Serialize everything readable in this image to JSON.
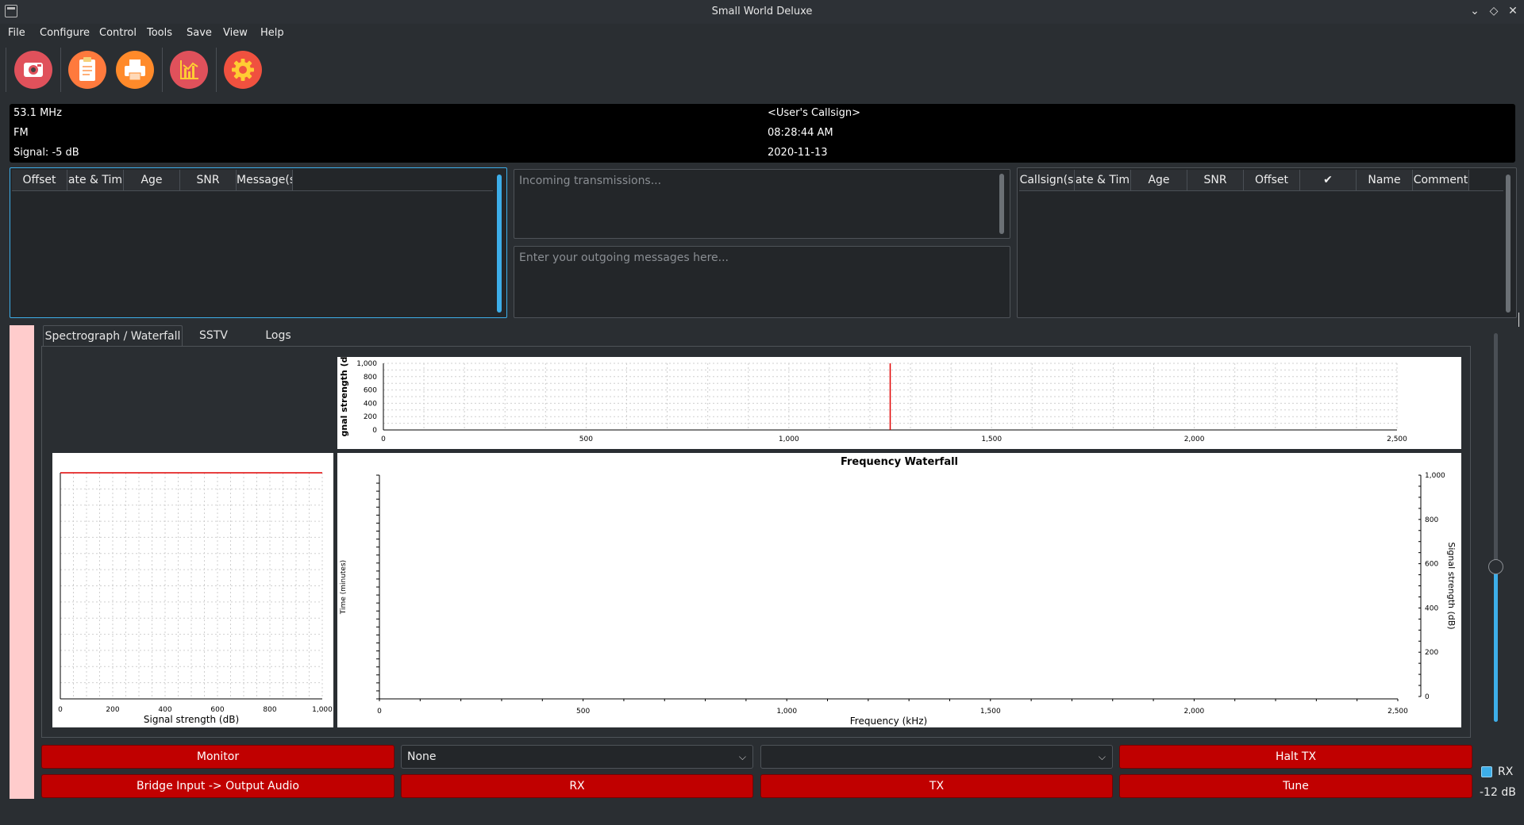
{
  "window": {
    "title": "Small World Deluxe"
  },
  "menu": [
    "File",
    "Configure",
    "Control",
    "Tools",
    "Save",
    "View",
    "Help"
  ],
  "toolbar": {
    "icons": [
      "camera-icon",
      "clipboard-icon",
      "printer-icon",
      "chart-icon",
      "settings-gear-icon"
    ],
    "colors": {
      "camera": "#e0515b",
      "clipboard": "#ff7a3d",
      "printer": "#ff8a2a",
      "chart": "#e0515b",
      "gear": "#f0513f"
    }
  },
  "info": {
    "frequency": "53.1 MHz",
    "mode": "FM",
    "signal": "Signal: -5 dB",
    "callsign": "<User's Callsign>",
    "time": "08:28:44 AM",
    "date": "2020-11-13"
  },
  "left_table": {
    "columns": [
      "Offset",
      "ate & Tim",
      "Age",
      "SNR",
      "Message(s"
    ]
  },
  "incoming": {
    "placeholder": "Incoming transmissions..."
  },
  "outgoing": {
    "placeholder": "Enter your outgoing messages here..."
  },
  "right_table": {
    "columns": [
      "Callsign(s",
      "ate & Tim",
      "Age",
      "SNR",
      "Offset",
      "✔",
      "Name",
      "Comment"
    ]
  },
  "tabs": [
    "Spectrograph / Waterfall",
    "SSTV",
    "Logs"
  ],
  "spectrum_chart": {
    "ylabel": "gnal strength (d",
    "y_ticks": [
      "1,000",
      "800",
      "600",
      "400",
      "200",
      "0"
    ],
    "x_ticks": [
      "0",
      "500",
      "1,000",
      "1,500",
      "2,000",
      "2,500"
    ],
    "marker_x": 1250
  },
  "signal_chart": {
    "xlabel": "Signal strength (dB)",
    "x_ticks": [
      "0",
      "200",
      "400",
      "600",
      "800",
      "1,000"
    ]
  },
  "waterfall_chart": {
    "title": "Frequency Waterfall",
    "xlabel": "Frequency (kHz)",
    "ylabel_left": "Time (minutes)",
    "ylabel_right": "Signal strength (dB)",
    "x_ticks": [
      "0",
      "500",
      "1,000",
      "1,500",
      "2,000",
      "2,500"
    ],
    "right_ticks": [
      "1,000",
      "800",
      "600",
      "400",
      "200",
      "0"
    ]
  },
  "controls": {
    "monitor": "Monitor",
    "combo1": "None",
    "combo2": "",
    "halt_tx": "Halt TX",
    "bridge": "Bridge Input -> Output Audio",
    "rx": "RX",
    "tx": "TX",
    "tune": "Tune"
  },
  "side": {
    "rx_label": "RX",
    "db_label": "-12 dB",
    "slider_level": 0.4
  }
}
